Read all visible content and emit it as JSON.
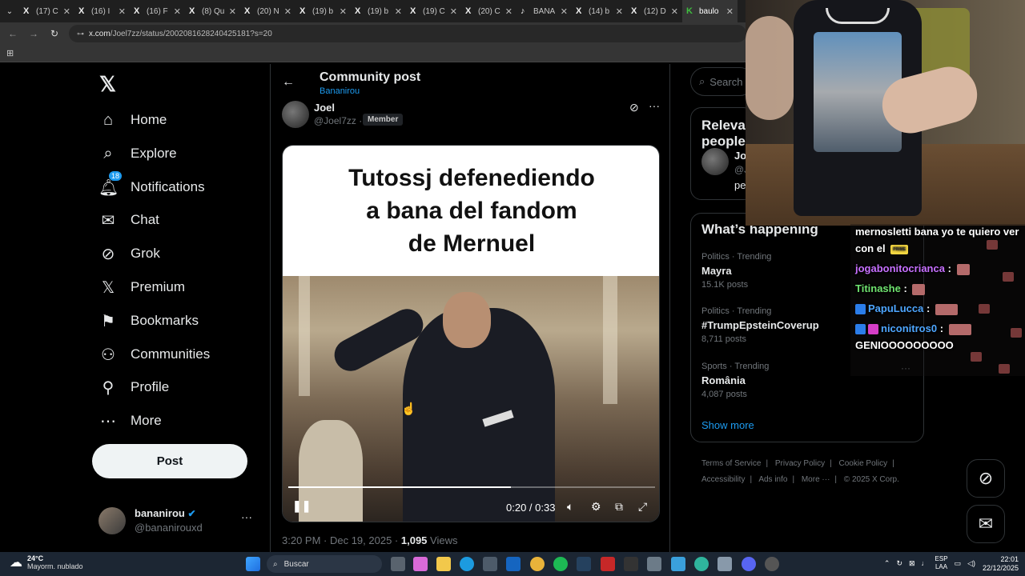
{
  "browser": {
    "tabs": [
      {
        "icon": "X",
        "label": "(17) C"
      },
      {
        "icon": "X",
        "label": "(16) I"
      },
      {
        "icon": "X",
        "label": "(16) F"
      },
      {
        "icon": "X",
        "label": "(8) Qu"
      },
      {
        "icon": "X",
        "label": "(20) N"
      },
      {
        "icon": "X",
        "label": "(19) b"
      },
      {
        "icon": "X",
        "label": "(19) b"
      },
      {
        "icon": "X",
        "label": "(19) C"
      },
      {
        "icon": "X",
        "label": "(20) C"
      },
      {
        "icon": "♪",
        "label": "BANA"
      },
      {
        "icon": "X",
        "label": "(14) b"
      },
      {
        "icon": "X",
        "label": "(12) D"
      },
      {
        "icon": "K",
        "label": "baulo"
      }
    ],
    "url_host": "x.com",
    "url_path": "/Joel7zz/status/2002081628240425181?s=20"
  },
  "nav": {
    "items": [
      {
        "label": "Home",
        "icon": "home-icon"
      },
      {
        "label": "Explore",
        "icon": "search-icon"
      },
      {
        "label": "Notifications",
        "icon": "bell-icon",
        "badge": "18"
      },
      {
        "label": "Chat",
        "icon": "envelope-icon"
      },
      {
        "label": "Grok",
        "icon": "grok-icon"
      },
      {
        "label": "Premium",
        "icon": "x-logo-icon"
      },
      {
        "label": "Bookmarks",
        "icon": "bookmark-icon"
      },
      {
        "label": "Communities",
        "icon": "communities-icon"
      },
      {
        "label": "Profile",
        "icon": "person-icon"
      },
      {
        "label": "More",
        "icon": "more-circle-icon"
      }
    ],
    "post_label": "Post",
    "account": {
      "name": "bananirou",
      "handle": "@bananirouxd"
    }
  },
  "header": {
    "title": "Community post",
    "community": "Bananirou"
  },
  "post": {
    "author_name": "Joel",
    "author_handle": "@Joel7zz",
    "separator": "·",
    "role_badge": "Member",
    "caption": "Tutossj defenediendo\na bana del fandom\nde Mernuel",
    "video": {
      "timecode": "0:20 / 0:33",
      "progress": 0.606
    },
    "time": "3:20 PM · Dec 19, 2025 ·",
    "views_count": "1,095",
    "views_label": "Views"
  },
  "right": {
    "search_placeholder": "Search",
    "relevant": {
      "title": "Relevant people",
      "name": "Joel",
      "handle": "@J",
      "bio": "pe"
    },
    "happening": {
      "title": "What’s happening",
      "trends": [
        {
          "category": "Politics · Trending",
          "name": "Mayra",
          "count": "15.1K posts"
        },
        {
          "category": "Politics · Trending",
          "name": "#TrumpEpsteinCoverup",
          "count": "8,711 posts"
        },
        {
          "category": "Sports · Trending",
          "name": "România",
          "count": "4,087 posts"
        }
      ],
      "show_more": "Show more"
    },
    "footer": [
      "Terms of Service",
      "Privacy Policy",
      "Cookie Policy",
      "Accessibility",
      "Ads info",
      "More ···",
      "© 2025 X Corp."
    ]
  },
  "chat": {
    "line1": "mernosletti bana yo te quiero ver",
    "line2": "con el",
    "prime": "PRIME",
    "users": [
      "jogabonitocrianca",
      "Titinashe",
      "PapuLucca",
      "niconitros0"
    ],
    "colon": ":",
    "last_message": "GENIOOOOOOOOO"
  },
  "taskbar": {
    "temp": "24°C",
    "weather_desc": "Mayorm. nublado",
    "search_label": "Buscar",
    "lang_top": "ESP",
    "lang_bottom": "LAA",
    "time": "22:01",
    "date": "22/12/2025"
  },
  "colors": {
    "accent": "#1d9bf0",
    "background": "#000000",
    "text": "#e7e9ea",
    "muted": "#71767b"
  }
}
